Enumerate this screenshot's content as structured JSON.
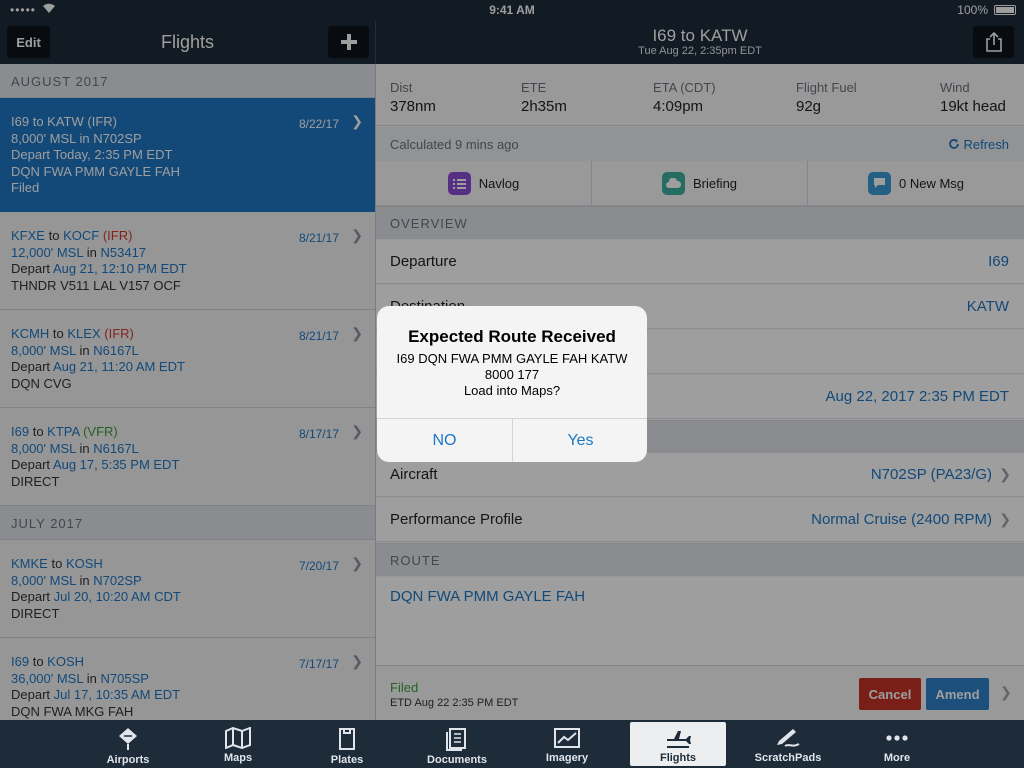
{
  "status": {
    "carrier": "•••••",
    "time": "9:41 AM",
    "battery": "100%"
  },
  "left_nav": {
    "edit": "Edit",
    "title": "Flights",
    "add": "+"
  },
  "right_nav": {
    "title": "I69 to KATW",
    "subtitle": "Tue Aug 22, 2:35pm EDT"
  },
  "flights": {
    "sections": [
      {
        "header": "AUGUST 2017",
        "items": [
          {
            "from": "I69",
            "to": "KATW",
            "tag": "(IFR)",
            "tag_type": "ifr",
            "date": "8/22/17",
            "alt": "8,000' MSL",
            "tail": "N702SP",
            "depart": "Today, 2:35 PM EDT",
            "route": "DQN FWA PMM GAYLE FAH",
            "status": "Filed",
            "selected": true
          },
          {
            "from": "KFXE",
            "to": "KOCF",
            "tag": "(IFR)",
            "tag_type": "ifr",
            "date": "8/21/17",
            "alt": "12,000' MSL",
            "tail": "N53417",
            "depart": "Aug 21, 12:10 PM EDT",
            "route": "THNDR V511 LAL V157 OCF"
          },
          {
            "from": "KCMH",
            "to": "KLEX",
            "tag": "(IFR)",
            "tag_type": "ifr",
            "date": "8/21/17",
            "alt": "8,000' MSL",
            "tail": "N6167L",
            "depart": "Aug 21, 11:20 AM EDT",
            "route": "DQN CVG"
          },
          {
            "from": "I69",
            "to": "KTPA",
            "tag": "(VFR)",
            "tag_type": "vfr",
            "date": "8/17/17",
            "alt": "8,000' MSL",
            "tail": "N6167L",
            "depart": "Aug 17, 5:35 PM EDT",
            "route": "DIRECT"
          }
        ]
      },
      {
        "header": "JULY 2017",
        "items": [
          {
            "from": "KMKE",
            "to": "KOSH",
            "tag": "",
            "tag_type": "",
            "date": "7/20/17",
            "alt": "8,000' MSL",
            "tail": "N702SP",
            "depart": "Jul 20, 10:20 AM CDT",
            "route": "DIRECT"
          },
          {
            "from": "I69",
            "to": "KOSH",
            "tag": "",
            "tag_type": "",
            "date": "7/17/17",
            "alt": "36,000' MSL",
            "tail": "N705SP",
            "depart": "Jul 17, 10:35 AM EDT",
            "route": "DQN FWA MKG FAH"
          }
        ]
      }
    ],
    "words": {
      "to": "to",
      "in": "in",
      "depart": "Depart"
    }
  },
  "stats": [
    {
      "label": "Dist",
      "value": "378nm"
    },
    {
      "label": "ETE",
      "value": "2h35m"
    },
    {
      "label": "ETA (CDT)",
      "value": "4:09pm"
    },
    {
      "label": "Flight Fuel",
      "value": "92g"
    },
    {
      "label": "Wind",
      "value": "19kt head"
    }
  ],
  "calc": {
    "text": "Calculated 9 mins ago",
    "refresh": "Refresh"
  },
  "tabs": {
    "navlog": "Navlog",
    "briefing": "Briefing",
    "msg": "0 New Msg"
  },
  "overview": {
    "header": "OVERVIEW",
    "departure_label": "Departure",
    "departure_value": "I69",
    "destination_label": "Destination",
    "destination_value": "KATW",
    "time_value": "Aug 22, 2017 2:35 PM EDT",
    "aircraft_label": "Aircraft",
    "aircraft_value": "N702SP (PA23/G)",
    "profile_label": "Performance Profile",
    "profile_value": "Normal Cruise (2400 RPM)"
  },
  "route": {
    "header": "ROUTE",
    "value": "DQN FWA PMM GAYLE FAH"
  },
  "footer": {
    "status": "Filed",
    "etd": "ETD Aug 22 2:35 PM EDT",
    "cancel": "Cancel",
    "amend": "Amend"
  },
  "alert": {
    "title": "Expected Route Received",
    "line1": "I69 DQN FWA PMM GAYLE FAH KATW",
    "line2": "8000 177",
    "line3": "Load into Maps?",
    "no": "NO",
    "yes": "Yes"
  },
  "tabbar": [
    {
      "label": "Airports",
      "icon": "airport-icon"
    },
    {
      "label": "Maps",
      "icon": "map-icon"
    },
    {
      "label": "Plates",
      "icon": "plates-icon"
    },
    {
      "label": "Documents",
      "icon": "documents-icon"
    },
    {
      "label": "Imagery",
      "icon": "imagery-icon"
    },
    {
      "label": "Flights",
      "icon": "plane-icon",
      "active": true
    },
    {
      "label": "ScratchPads",
      "icon": "pen-icon"
    },
    {
      "label": "More",
      "icon": "more-icon"
    }
  ],
  "colors": {
    "nav": "#1e2c3a",
    "accent": "#1d77c3",
    "selected": "#1d77c3",
    "ifr": "#d43a2c",
    "vfr": "#3a9d3a",
    "cancel": "#c33226"
  }
}
